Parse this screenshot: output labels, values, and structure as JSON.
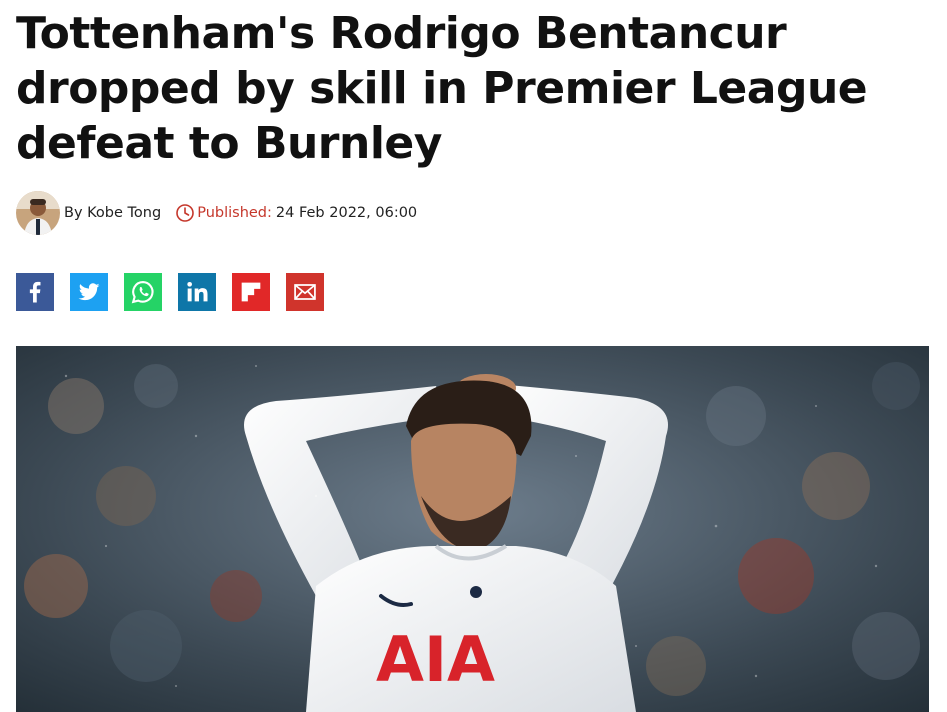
{
  "article": {
    "headline": "Tottenham's Rodrigo Bentancur dropped by skill in Premier League defeat to Burnley",
    "byline_prefix": "By",
    "author": "Kobe Tong",
    "published_label": "Published:",
    "published_date": "24 Feb 2022, 06:00",
    "hero_shirt_text": "AIA"
  },
  "share_buttons": [
    {
      "network": "facebook",
      "icon": "facebook-icon",
      "color": "#3b5998"
    },
    {
      "network": "twitter",
      "icon": "twitter-icon",
      "color": "#1da1f2"
    },
    {
      "network": "whatsapp",
      "icon": "whatsapp-icon",
      "color": "#25d366"
    },
    {
      "network": "linkedin",
      "icon": "linkedin-icon",
      "color": "#0e76a8"
    },
    {
      "network": "flipboard",
      "icon": "flipboard-icon",
      "color": "#e12828"
    },
    {
      "network": "email",
      "icon": "email-icon",
      "color": "#d0342c"
    }
  ],
  "colors": {
    "published_label": "#c5372b",
    "text": "#111111"
  }
}
